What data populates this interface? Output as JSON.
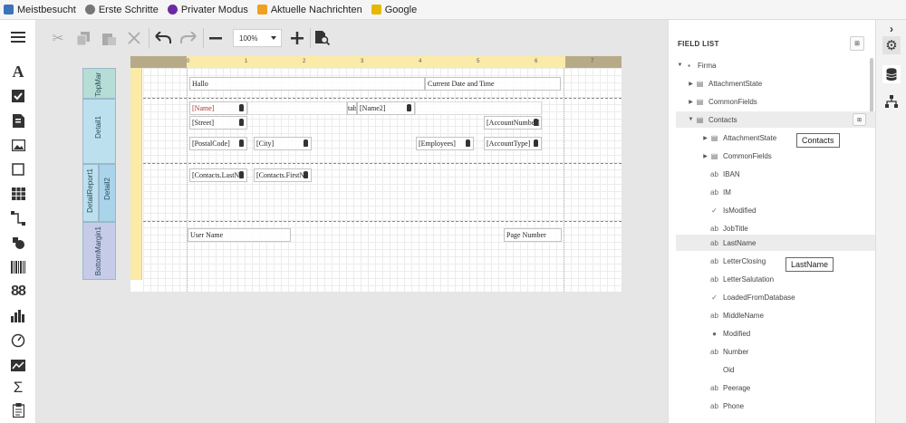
{
  "bookmarks": [
    {
      "label": "Meistbesucht",
      "color": "#3b73b9"
    },
    {
      "label": "Erste Schritte",
      "color": "#777777"
    },
    {
      "label": "Privater Modus",
      "color": "#6a2aa8"
    },
    {
      "label": "Aktuelle Nachrichten",
      "color": "#f0a020"
    },
    {
      "label": "Google",
      "color": "#e6b800"
    }
  ],
  "toolbar": {
    "zoom_value": "100%"
  },
  "design": {
    "bands": [
      "TopMar",
      "Detail1",
      "DetailReport1",
      "Detail2",
      "BottomMargin1"
    ],
    "ruler_numbers": [
      "0",
      "1",
      "2",
      "3",
      "4",
      "5",
      "6",
      "7"
    ],
    "controls": {
      "hallo": "Hallo",
      "current_date": "Current Date and Time",
      "name": "[Name]",
      "tab": "tab",
      "name2": "[Name2]",
      "street": "[Street]",
      "account_number": "[AccountNumber]",
      "postal_code": "[PostalCode]",
      "city": "[City]",
      "employees": "[Employees]",
      "account_type": "[AccountType]",
      "contacts_lastname": "[Contacts.LastNa",
      "contacts_firstname": "[Contacts.FirstNa",
      "user_name": "User Name",
      "page_number": "Page Number"
    }
  },
  "field_list": {
    "title": "FIELD LIST",
    "items": [
      {
        "label": "Firma",
        "arrow": "▼",
        "icon": "▪"
      },
      {
        "label": "AttachmentState",
        "arrow": "▶",
        "icon": "▤"
      },
      {
        "label": "CommonFields",
        "arrow": "▶",
        "icon": "▤"
      },
      {
        "label": "Contacts",
        "arrow": "▼",
        "icon": "▤"
      },
      {
        "label": "AttachmentState",
        "arrow": "▶",
        "icon": "▤"
      },
      {
        "label": "CommonFields",
        "arrow": "▶",
        "icon": "▤"
      },
      {
        "label": "IBAN",
        "arrow": "",
        "icon": "ab"
      },
      {
        "label": "IM",
        "arrow": "",
        "icon": "ab"
      },
      {
        "label": "IsModified",
        "arrow": "",
        "icon": "✓"
      },
      {
        "label": "JobTitle",
        "arrow": "",
        "icon": "ab"
      },
      {
        "label": "LastName",
        "arrow": "",
        "icon": "ab"
      },
      {
        "label": "LetterClosing",
        "arrow": "",
        "icon": "ab"
      },
      {
        "label": "LetterSalutation",
        "arrow": "",
        "icon": "ab"
      },
      {
        "label": "LoadedFromDatabase",
        "arrow": "",
        "icon": "✓"
      },
      {
        "label": "MiddleName",
        "arrow": "",
        "icon": "ab"
      },
      {
        "label": "Modified",
        "arrow": "",
        "icon": "●"
      },
      {
        "label": "Number",
        "arrow": "",
        "icon": "ab"
      },
      {
        "label": "Oid",
        "arrow": "",
        "icon": ""
      },
      {
        "label": "Peerage",
        "arrow": "",
        "icon": "ab"
      },
      {
        "label": "Phone",
        "arrow": "",
        "icon": "ab"
      }
    ],
    "tooltips": {
      "contacts": "Contacts",
      "lastname": "LastName"
    }
  }
}
